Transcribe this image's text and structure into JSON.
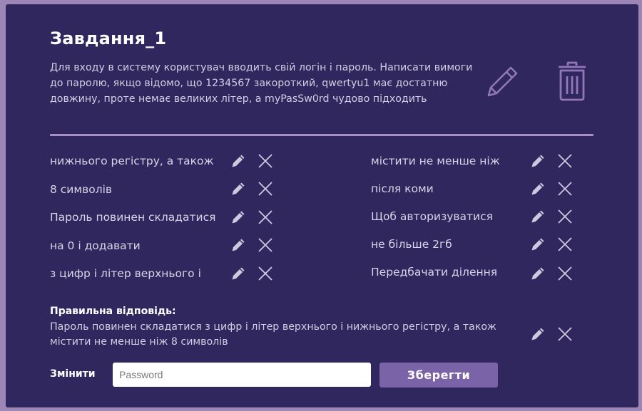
{
  "task": {
    "title": "Завдання_1",
    "description": "Для входу в систему користувач вводить свій логін і пароль. Написати вимоги до паролю, якщо відомо, що 1234567 закороткий, qwertyu1 має достатню довжину, проте немає великих літер, а myPasSw0rd чудово підходить"
  },
  "header_icons": {
    "edit": "pencil-icon",
    "delete": "trash-icon"
  },
  "fragments_left": [
    "нижнього регістру, а також",
    "8 символів",
    "Пароль повинен складатися",
    "на 0 і додавати",
    "з цифр і літер верхнього і"
  ],
  "fragments_right": [
    "містити не менше ніж",
    "після коми",
    "Щоб авторизуватися",
    "не більше 2гб",
    "Передбачати ділення"
  ],
  "answer": {
    "label": "Правильна відповідь:",
    "text": "Пароль повинен складатися з  цифр і літер верхнього і нижнього регістру, а також містити не менше ніж 8 символів"
  },
  "footer": {
    "change_label": "Змінити",
    "password_placeholder": "Password",
    "save_label": "Зберегти"
  },
  "colors": {
    "background": "#9b86b5",
    "card": "#30275e",
    "accent": "#7b63a8",
    "icon": "#a690c8"
  }
}
